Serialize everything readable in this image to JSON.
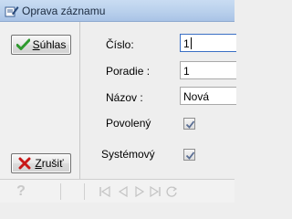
{
  "window": {
    "title": "Oprava záznamu",
    "icon": "edit-record-icon"
  },
  "buttons": {
    "accept": {
      "label_prefix": "",
      "label_mnemonic": "S",
      "label_rest": "úhlas",
      "icon": "green-check-icon"
    },
    "cancel": {
      "label_prefix": "",
      "label_mnemonic": "Z",
      "label_rest": "rušiť",
      "icon": "red-x-icon"
    }
  },
  "form": {
    "cislo": {
      "label": "Číslo:",
      "value": "1"
    },
    "poradie": {
      "label": "Poradie :",
      "value": "1"
    },
    "nazov": {
      "label": "Názov :",
      "value": "Nová"
    },
    "povoleny": {
      "label": "Povolený",
      "checked": true
    },
    "systemovy": {
      "label": "Systémový",
      "checked": true
    }
  },
  "statusbar": {
    "help_glyph": "?",
    "nav_icons": [
      "first-record-icon",
      "prev-record-icon",
      "next-record-icon",
      "last-record-icon",
      "refresh-icon"
    ]
  },
  "colors": {
    "title_bar": "#b9d0ec",
    "check_green": "#2e9a2e",
    "cancel_red": "#c81818",
    "checkbox_mark": "#5a6e94"
  }
}
